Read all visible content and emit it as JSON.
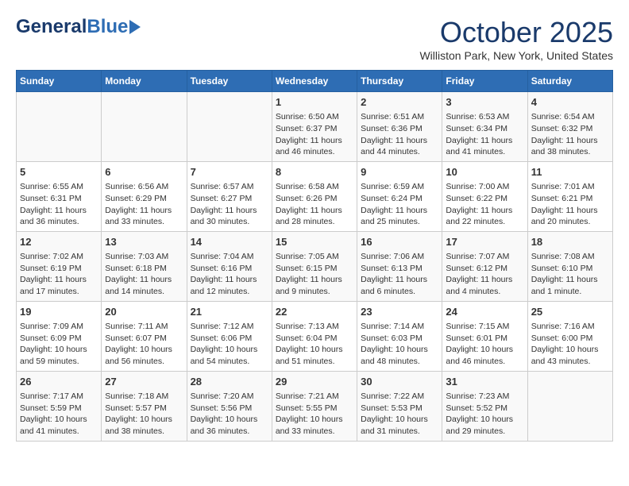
{
  "header": {
    "logo_general": "General",
    "logo_blue": "Blue",
    "month_title": "October 2025",
    "location": "Williston Park, New York, United States"
  },
  "weekdays": [
    "Sunday",
    "Monday",
    "Tuesday",
    "Wednesday",
    "Thursday",
    "Friday",
    "Saturday"
  ],
  "weeks": [
    [
      {
        "day": "",
        "info": ""
      },
      {
        "day": "",
        "info": ""
      },
      {
        "day": "",
        "info": ""
      },
      {
        "day": "1",
        "info": "Sunrise: 6:50 AM\nSunset: 6:37 PM\nDaylight: 11 hours\nand 46 minutes."
      },
      {
        "day": "2",
        "info": "Sunrise: 6:51 AM\nSunset: 6:36 PM\nDaylight: 11 hours\nand 44 minutes."
      },
      {
        "day": "3",
        "info": "Sunrise: 6:53 AM\nSunset: 6:34 PM\nDaylight: 11 hours\nand 41 minutes."
      },
      {
        "day": "4",
        "info": "Sunrise: 6:54 AM\nSunset: 6:32 PM\nDaylight: 11 hours\nand 38 minutes."
      }
    ],
    [
      {
        "day": "5",
        "info": "Sunrise: 6:55 AM\nSunset: 6:31 PM\nDaylight: 11 hours\nand 36 minutes."
      },
      {
        "day": "6",
        "info": "Sunrise: 6:56 AM\nSunset: 6:29 PM\nDaylight: 11 hours\nand 33 minutes."
      },
      {
        "day": "7",
        "info": "Sunrise: 6:57 AM\nSunset: 6:27 PM\nDaylight: 11 hours\nand 30 minutes."
      },
      {
        "day": "8",
        "info": "Sunrise: 6:58 AM\nSunset: 6:26 PM\nDaylight: 11 hours\nand 28 minutes."
      },
      {
        "day": "9",
        "info": "Sunrise: 6:59 AM\nSunset: 6:24 PM\nDaylight: 11 hours\nand 25 minutes."
      },
      {
        "day": "10",
        "info": "Sunrise: 7:00 AM\nSunset: 6:22 PM\nDaylight: 11 hours\nand 22 minutes."
      },
      {
        "day": "11",
        "info": "Sunrise: 7:01 AM\nSunset: 6:21 PM\nDaylight: 11 hours\nand 20 minutes."
      }
    ],
    [
      {
        "day": "12",
        "info": "Sunrise: 7:02 AM\nSunset: 6:19 PM\nDaylight: 11 hours\nand 17 minutes."
      },
      {
        "day": "13",
        "info": "Sunrise: 7:03 AM\nSunset: 6:18 PM\nDaylight: 11 hours\nand 14 minutes."
      },
      {
        "day": "14",
        "info": "Sunrise: 7:04 AM\nSunset: 6:16 PM\nDaylight: 11 hours\nand 12 minutes."
      },
      {
        "day": "15",
        "info": "Sunrise: 7:05 AM\nSunset: 6:15 PM\nDaylight: 11 hours\nand 9 minutes."
      },
      {
        "day": "16",
        "info": "Sunrise: 7:06 AM\nSunset: 6:13 PM\nDaylight: 11 hours\nand 6 minutes."
      },
      {
        "day": "17",
        "info": "Sunrise: 7:07 AM\nSunset: 6:12 PM\nDaylight: 11 hours\nand 4 minutes."
      },
      {
        "day": "18",
        "info": "Sunrise: 7:08 AM\nSunset: 6:10 PM\nDaylight: 11 hours\nand 1 minute."
      }
    ],
    [
      {
        "day": "19",
        "info": "Sunrise: 7:09 AM\nSunset: 6:09 PM\nDaylight: 10 hours\nand 59 minutes."
      },
      {
        "day": "20",
        "info": "Sunrise: 7:11 AM\nSunset: 6:07 PM\nDaylight: 10 hours\nand 56 minutes."
      },
      {
        "day": "21",
        "info": "Sunrise: 7:12 AM\nSunset: 6:06 PM\nDaylight: 10 hours\nand 54 minutes."
      },
      {
        "day": "22",
        "info": "Sunrise: 7:13 AM\nSunset: 6:04 PM\nDaylight: 10 hours\nand 51 minutes."
      },
      {
        "day": "23",
        "info": "Sunrise: 7:14 AM\nSunset: 6:03 PM\nDaylight: 10 hours\nand 48 minutes."
      },
      {
        "day": "24",
        "info": "Sunrise: 7:15 AM\nSunset: 6:01 PM\nDaylight: 10 hours\nand 46 minutes."
      },
      {
        "day": "25",
        "info": "Sunrise: 7:16 AM\nSunset: 6:00 PM\nDaylight: 10 hours\nand 43 minutes."
      }
    ],
    [
      {
        "day": "26",
        "info": "Sunrise: 7:17 AM\nSunset: 5:59 PM\nDaylight: 10 hours\nand 41 minutes."
      },
      {
        "day": "27",
        "info": "Sunrise: 7:18 AM\nSunset: 5:57 PM\nDaylight: 10 hours\nand 38 minutes."
      },
      {
        "day": "28",
        "info": "Sunrise: 7:20 AM\nSunset: 5:56 PM\nDaylight: 10 hours\nand 36 minutes."
      },
      {
        "day": "29",
        "info": "Sunrise: 7:21 AM\nSunset: 5:55 PM\nDaylight: 10 hours\nand 33 minutes."
      },
      {
        "day": "30",
        "info": "Sunrise: 7:22 AM\nSunset: 5:53 PM\nDaylight: 10 hours\nand 31 minutes."
      },
      {
        "day": "31",
        "info": "Sunrise: 7:23 AM\nSunset: 5:52 PM\nDaylight: 10 hours\nand 29 minutes."
      },
      {
        "day": "",
        "info": ""
      }
    ]
  ]
}
